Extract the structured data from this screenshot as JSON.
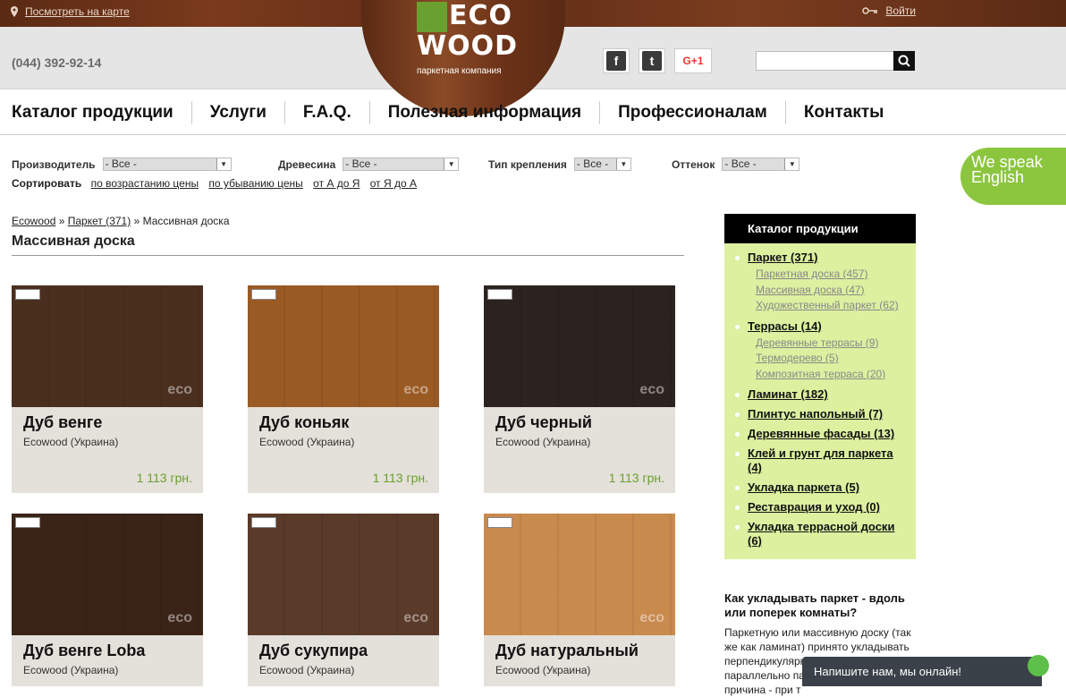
{
  "topbar": {
    "map_link": "Посмотреть на карте",
    "login": "Войти"
  },
  "header": {
    "phone": "(044) 392-92-14",
    "logo_line1": "eco",
    "logo_line2": "wood",
    "logo_tagline": "паркетная компания",
    "gplus": "G+1",
    "search_placeholder": ""
  },
  "nav": [
    "Каталог продукции",
    "Услуги",
    "F.A.Q.",
    "Полезная информация",
    "Профессионалам",
    "Контакты"
  ],
  "filters": {
    "manufacturer": {
      "label": "Производитель",
      "value": "- Все -"
    },
    "wood": {
      "label": "Древесина",
      "value": "- Все -"
    },
    "mount": {
      "label": "Тип крепления",
      "value": "- Все -"
    },
    "shade": {
      "label": "Оттенок",
      "value": "- Все -"
    },
    "sort_label": "Сортировать",
    "sort": [
      "по возрастанию цены",
      "по убыванию цены",
      "от А до Я",
      "от Я до А"
    ]
  },
  "badge": {
    "line1": "We speak",
    "line2": "English"
  },
  "breadcrumb": {
    "home": "Ecowood",
    "sep": "»",
    "parent": "Паркет (371)",
    "current": "Массивная доска"
  },
  "page_title": "Массивная доска",
  "products": [
    {
      "name": "Дуб венге",
      "mfr": "Ecowood (Украина)",
      "price": "1 113 грн.",
      "color": "#4a2e1e"
    },
    {
      "name": "Дуб коньяк",
      "mfr": "Ecowood (Украина)",
      "price": "1 113 грн.",
      "color": "#9a5a24"
    },
    {
      "name": "Дуб черный",
      "mfr": "Ecowood (Украина)",
      "price": "1 113 грн.",
      "color": "#2c2220"
    },
    {
      "name": "Дуб венге Loba",
      "mfr": "Ecowood (Украина)",
      "price": "",
      "color": "#3a2418"
    },
    {
      "name": "Дуб сукупира",
      "mfr": "Ecowood (Украина)",
      "price": "",
      "color": "#5a3a28"
    },
    {
      "name": "Дуб натуральный",
      "mfr": "Ecowood (Украина)",
      "price": "",
      "color": "#c98a4e"
    }
  ],
  "sidebar": {
    "title": "Каталог продукции",
    "main": [
      "Паркет (371)",
      "Террасы (14)",
      "Ламинат (182)",
      "Плинтус напольный (7)",
      "Деревянные фасады (13)",
      "Клей и грунт для паркета (4)",
      "Укладка паркета (5)",
      "Реставрация и уход (0)",
      "Укладка террасной доски (6)"
    ],
    "parket_sub": [
      "Паркетная доска (457)",
      "Массивная доска (47)",
      "Художественный паркет (62)"
    ],
    "terrace_sub": [
      "Деревянные террасы (9)",
      "Термодерево (5)",
      "Композитная терраса (20)"
    ]
  },
  "article": {
    "title": "Как укладывать паркет - вдоль или поперек комнаты?",
    "body": "Паркетную или массивную доску (так же как ламинат) принято укладывать перпендикулярно окну, то есть параллельно падающему свету. Эта причина - при т"
  },
  "chat": {
    "label": "Напишите нам, мы онлайн!"
  }
}
